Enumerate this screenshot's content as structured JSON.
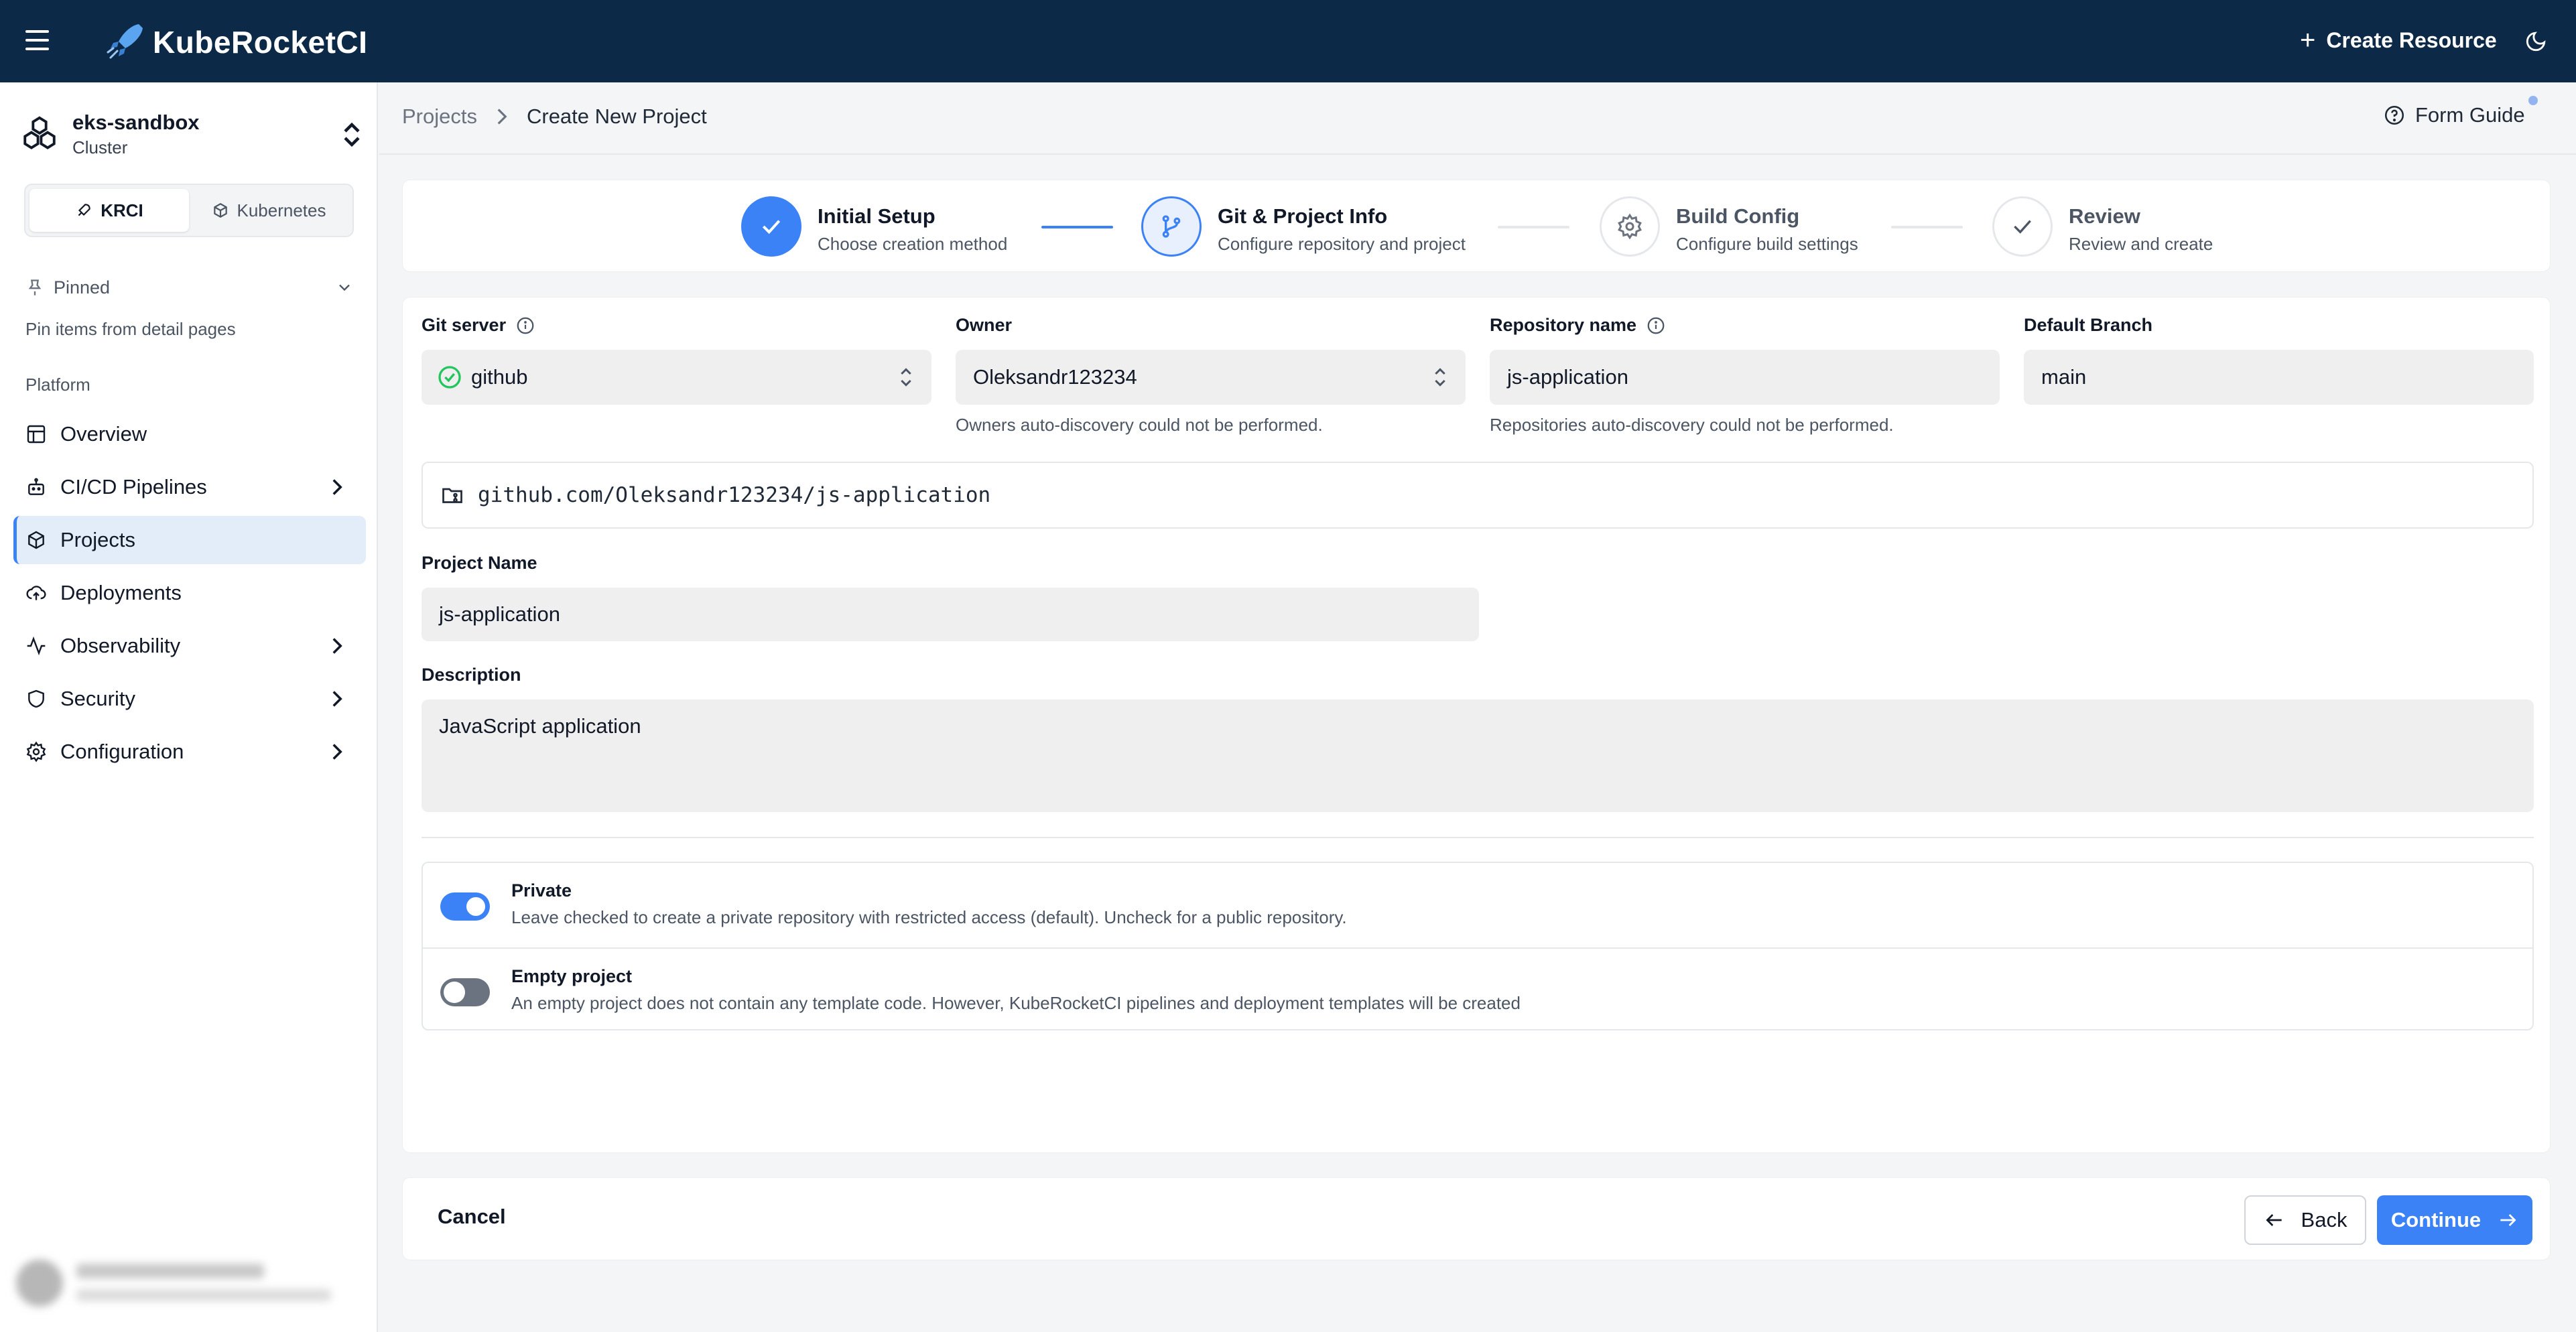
{
  "app": {
    "brand": "KubeRocketCI",
    "create_resource": "Create Resource"
  },
  "sidebar": {
    "cluster_name": "eks-sandbox",
    "cluster_type": "Cluster",
    "segments": [
      "KRCI",
      "Kubernetes"
    ],
    "pinned_label": "Pinned",
    "pinned_hint": "Pin items from detail pages",
    "section": "Platform",
    "items": [
      {
        "label": "Overview",
        "icon": "layout-icon"
      },
      {
        "label": "CI/CD Pipelines",
        "icon": "bot-icon"
      },
      {
        "label": "Projects",
        "icon": "box-icon"
      },
      {
        "label": "Deployments",
        "icon": "cloud-upload-icon"
      },
      {
        "label": "Observability",
        "icon": "activity-icon"
      },
      {
        "label": "Security",
        "icon": "shield-icon"
      },
      {
        "label": "Configuration",
        "icon": "gear-icon"
      }
    ]
  },
  "breadcrumb": {
    "root": "Projects",
    "current": "Create New Project"
  },
  "form_guide": "Form Guide",
  "stepper": [
    {
      "title": "Initial Setup",
      "subtitle": "Choose creation method",
      "state": "complete"
    },
    {
      "title": "Git & Project Info",
      "subtitle": "Configure repository and project",
      "state": "active"
    },
    {
      "title": "Build Config",
      "subtitle": "Configure build settings",
      "state": "pending"
    },
    {
      "title": "Review",
      "subtitle": "Review and create",
      "state": "pending"
    }
  ],
  "form": {
    "git_server": {
      "label": "Git server",
      "value": "github"
    },
    "owner": {
      "label": "Owner",
      "value": "Oleksandr123234",
      "help": "Owners auto-discovery could not be performed."
    },
    "repository": {
      "label": "Repository name",
      "value": "js-application",
      "help": "Repositories auto-discovery could not be performed."
    },
    "default_branch": {
      "label": "Default Branch",
      "value": "main"
    },
    "repo_url": "github.com/Oleksandr123234/js-application",
    "project_name": {
      "label": "Project Name",
      "value": "js-application"
    },
    "description": {
      "label": "Description",
      "value": "JavaScript application"
    },
    "private": {
      "label": "Private",
      "description": "Leave checked to create a private repository with restricted access (default). Uncheck for a public repository.",
      "checked": true
    },
    "empty_project": {
      "label": "Empty project",
      "description": "An empty project does not contain any template code. However, KubeRocketCI pipelines and deployment templates will be created",
      "checked": false
    }
  },
  "footer": {
    "cancel": "Cancel",
    "back": "Back",
    "continue": "Continue"
  },
  "colors": {
    "topbar": "#0c2a47",
    "accent": "#3b82f6",
    "success": "#22c55e"
  }
}
